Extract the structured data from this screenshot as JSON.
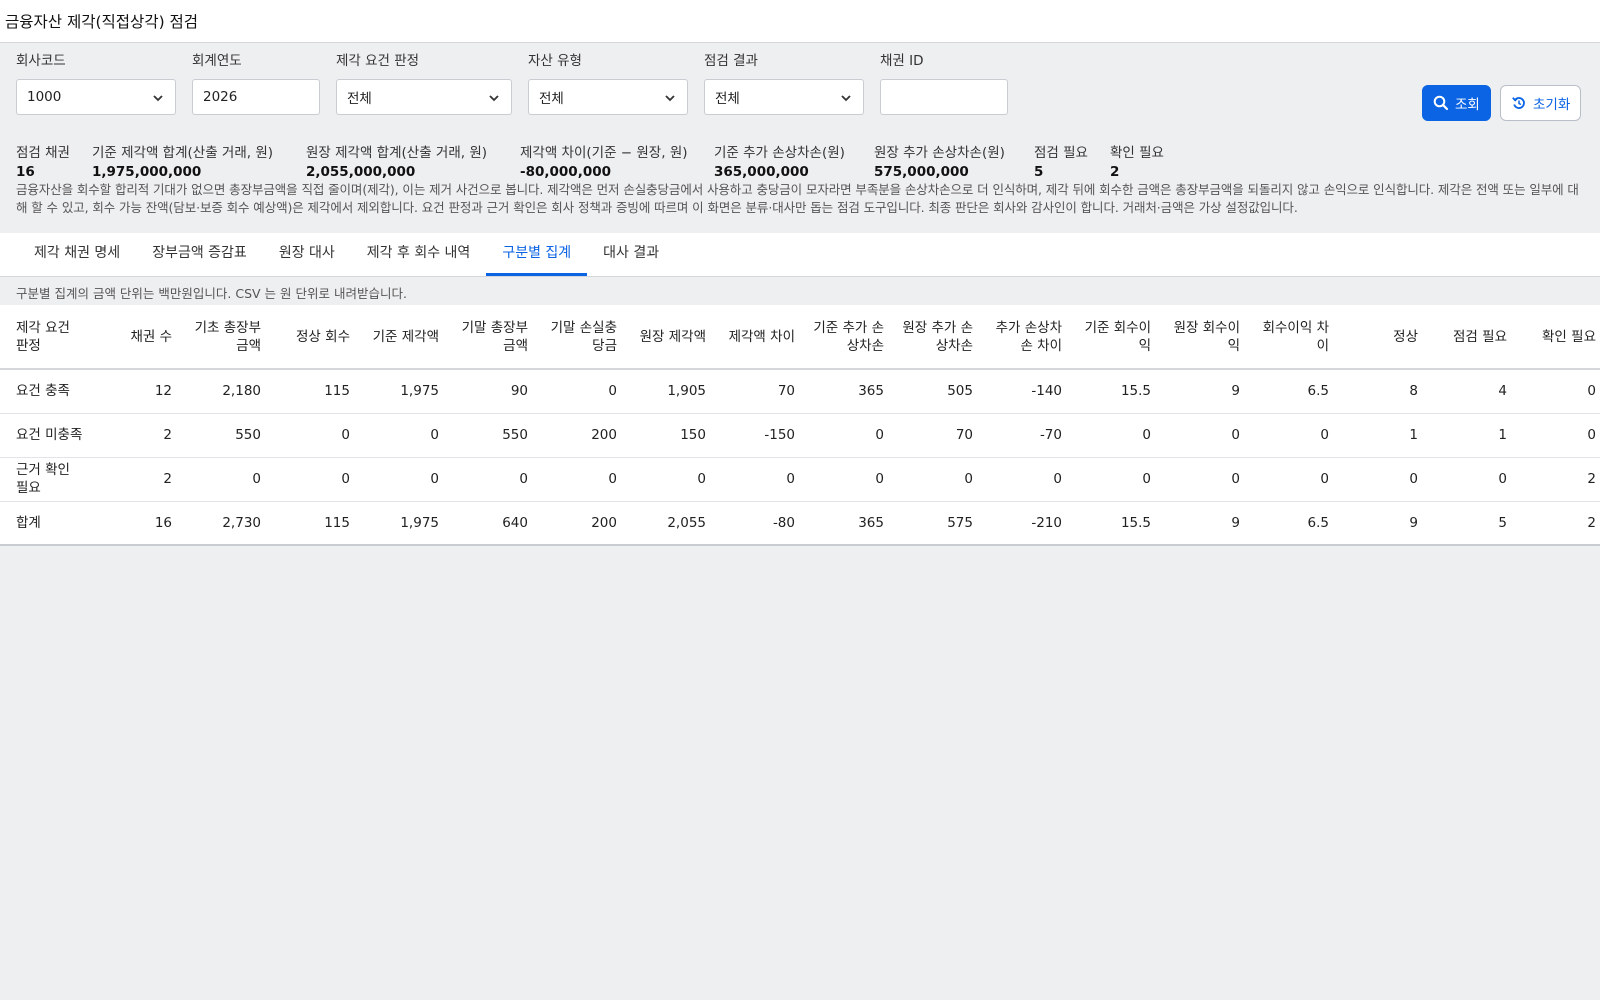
{
  "title": "금융자산 제각(직접상각) 점검",
  "filters": {
    "company_code": {
      "label": "회사코드",
      "value": "1000"
    },
    "fiscal_year": {
      "label": "회계연도",
      "value": "2026"
    },
    "requirement": {
      "label": "제각 요건 판정",
      "value": "전체"
    },
    "asset_type": {
      "label": "자산 유형",
      "value": "전체"
    },
    "result": {
      "label": "점검 결과",
      "value": "전체"
    },
    "bond_id": {
      "label": "채권 ID",
      "value": ""
    }
  },
  "buttons": {
    "search": "조회",
    "reset": "초기화"
  },
  "summary": [
    {
      "label": "점검 채권",
      "value": "16"
    },
    {
      "label": "기준 제각액 합계(산출 거래, 원)",
      "value": "1,975,000,000"
    },
    {
      "label": "원장 제각액 합계(산출 거래, 원)",
      "value": "2,055,000,000"
    },
    {
      "label": "제각액 차이(기준 − 원장, 원)",
      "value": "-80,000,000"
    },
    {
      "label": "기준 추가 손상차손(원)",
      "value": "365,000,000"
    },
    {
      "label": "원장 추가 손상차손(원)",
      "value": "575,000,000"
    },
    {
      "label": "점검 필요",
      "value": "5"
    },
    {
      "label": "확인 필요",
      "value": "2"
    }
  ],
  "note": "금융자산을 회수할 합리적 기대가 없으면 총장부금액을 직접 줄이며(제각), 이는 제거 사건으로 봅니다. 제각액은 먼저 손실충당금에서 사용하고 충당금이 모자라면 부족분을 손상차손으로 더 인식하며, 제각 뒤에 회수한 금액은 총장부금액을 되돌리지 않고 손익으로 인식합니다. 제각은 전액 또는 일부에 대해 할 수 있고, 회수 가능 잔액(담보·보증 회수 예상액)은 제각에서 제외합니다. 요건 판정과 근거 확인은 회사 정책과 증빙에 따르며 이 화면은 분류·대사만 돕는 점검 도구입니다. 최종 판단은 회사와 감사인이 합니다. 거래처·금액은 가상 설정값입니다.",
  "tabs": [
    "제각 채권 명세",
    "장부금액 증감표",
    "원장 대사",
    "제각 후 회수 내역",
    "구분별 집계",
    "대사 결과"
  ],
  "active_tab": 4,
  "hint": "구분별 집계의 금액 단위는 백만원입니다. CSV 는 원 단위로 내려받습니다.",
  "table": {
    "headers": [
      "제각 요건 판정",
      "채권 수",
      "기초 총장부금액",
      "정상 회수",
      "기준 제각액",
      "기말 총장부금액",
      "기말 손실충당금",
      "원장 제각액",
      "제각액 차이",
      "기준 추가 손상차손",
      "원장 추가 손상차손",
      "추가 손상차손 차이",
      "기준 회수이익",
      "원장 회수이익",
      "회수이익 차이",
      "정상",
      "점검 필요",
      "확인 필요"
    ],
    "rows": [
      [
        "요건 충족",
        "12",
        "2,180",
        "115",
        "1,975",
        "90",
        "0",
        "1,905",
        "70",
        "365",
        "505",
        "-140",
        "15.5",
        "9",
        "6.5",
        "8",
        "4",
        "0"
      ],
      [
        "요건 미충족",
        "2",
        "550",
        "0",
        "0",
        "550",
        "200",
        "150",
        "-150",
        "0",
        "70",
        "-70",
        "0",
        "0",
        "0",
        "1",
        "1",
        "0"
      ],
      [
        "근거 확인 필요",
        "2",
        "0",
        "0",
        "0",
        "0",
        "0",
        "0",
        "0",
        "0",
        "0",
        "0",
        "0",
        "0",
        "0",
        "0",
        "0",
        "2"
      ],
      [
        "합계",
        "16",
        "2,730",
        "115",
        "1,975",
        "640",
        "200",
        "2,055",
        "-80",
        "365",
        "575",
        "-210",
        "15.5",
        "9",
        "6.5",
        "9",
        "5",
        "2"
      ]
    ]
  }
}
